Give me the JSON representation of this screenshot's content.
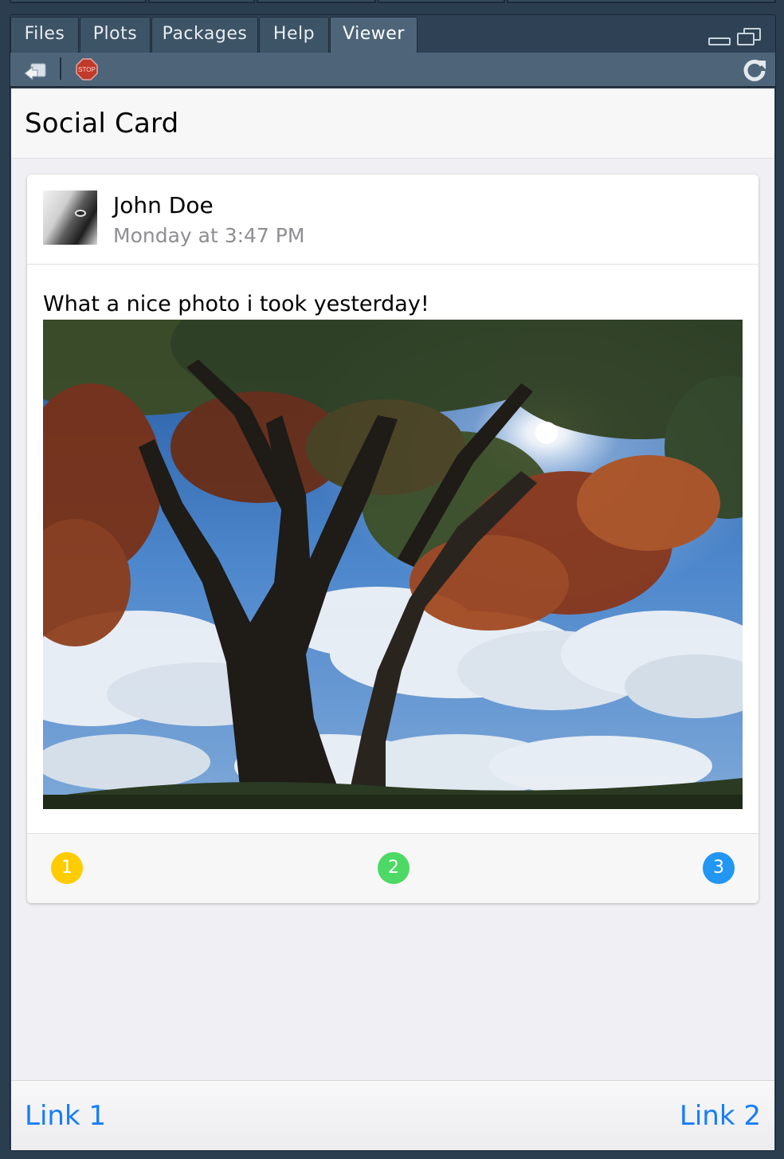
{
  "tabs": [
    {
      "label": "Files"
    },
    {
      "label": "Plots"
    },
    {
      "label": "Packages"
    },
    {
      "label": "Help"
    },
    {
      "label": "Viewer"
    }
  ],
  "active_tab": "Viewer",
  "toolbar": {
    "export_icon": "export-icon",
    "stop_icon": "stop-icon",
    "stop_label": "STOP",
    "refresh_icon": "refresh-icon"
  },
  "app": {
    "title": "Social Card"
  },
  "card": {
    "author": "John Doe",
    "date": "Monday at 3:47 PM",
    "text": "What a nice photo i took yesterday!",
    "footer_badges": [
      {
        "label": "1",
        "color": "#ffcc00"
      },
      {
        "label": "2",
        "color": "#4cd964"
      },
      {
        "label": "3",
        "color": "#2196f3"
      }
    ]
  },
  "bottom_links": [
    {
      "label": "Link 1"
    },
    {
      "label": "Link 2"
    }
  ],
  "colors": {
    "link": "#157efb",
    "pane_bg": "#2f4255",
    "viewer_bg": "#efeff4"
  }
}
